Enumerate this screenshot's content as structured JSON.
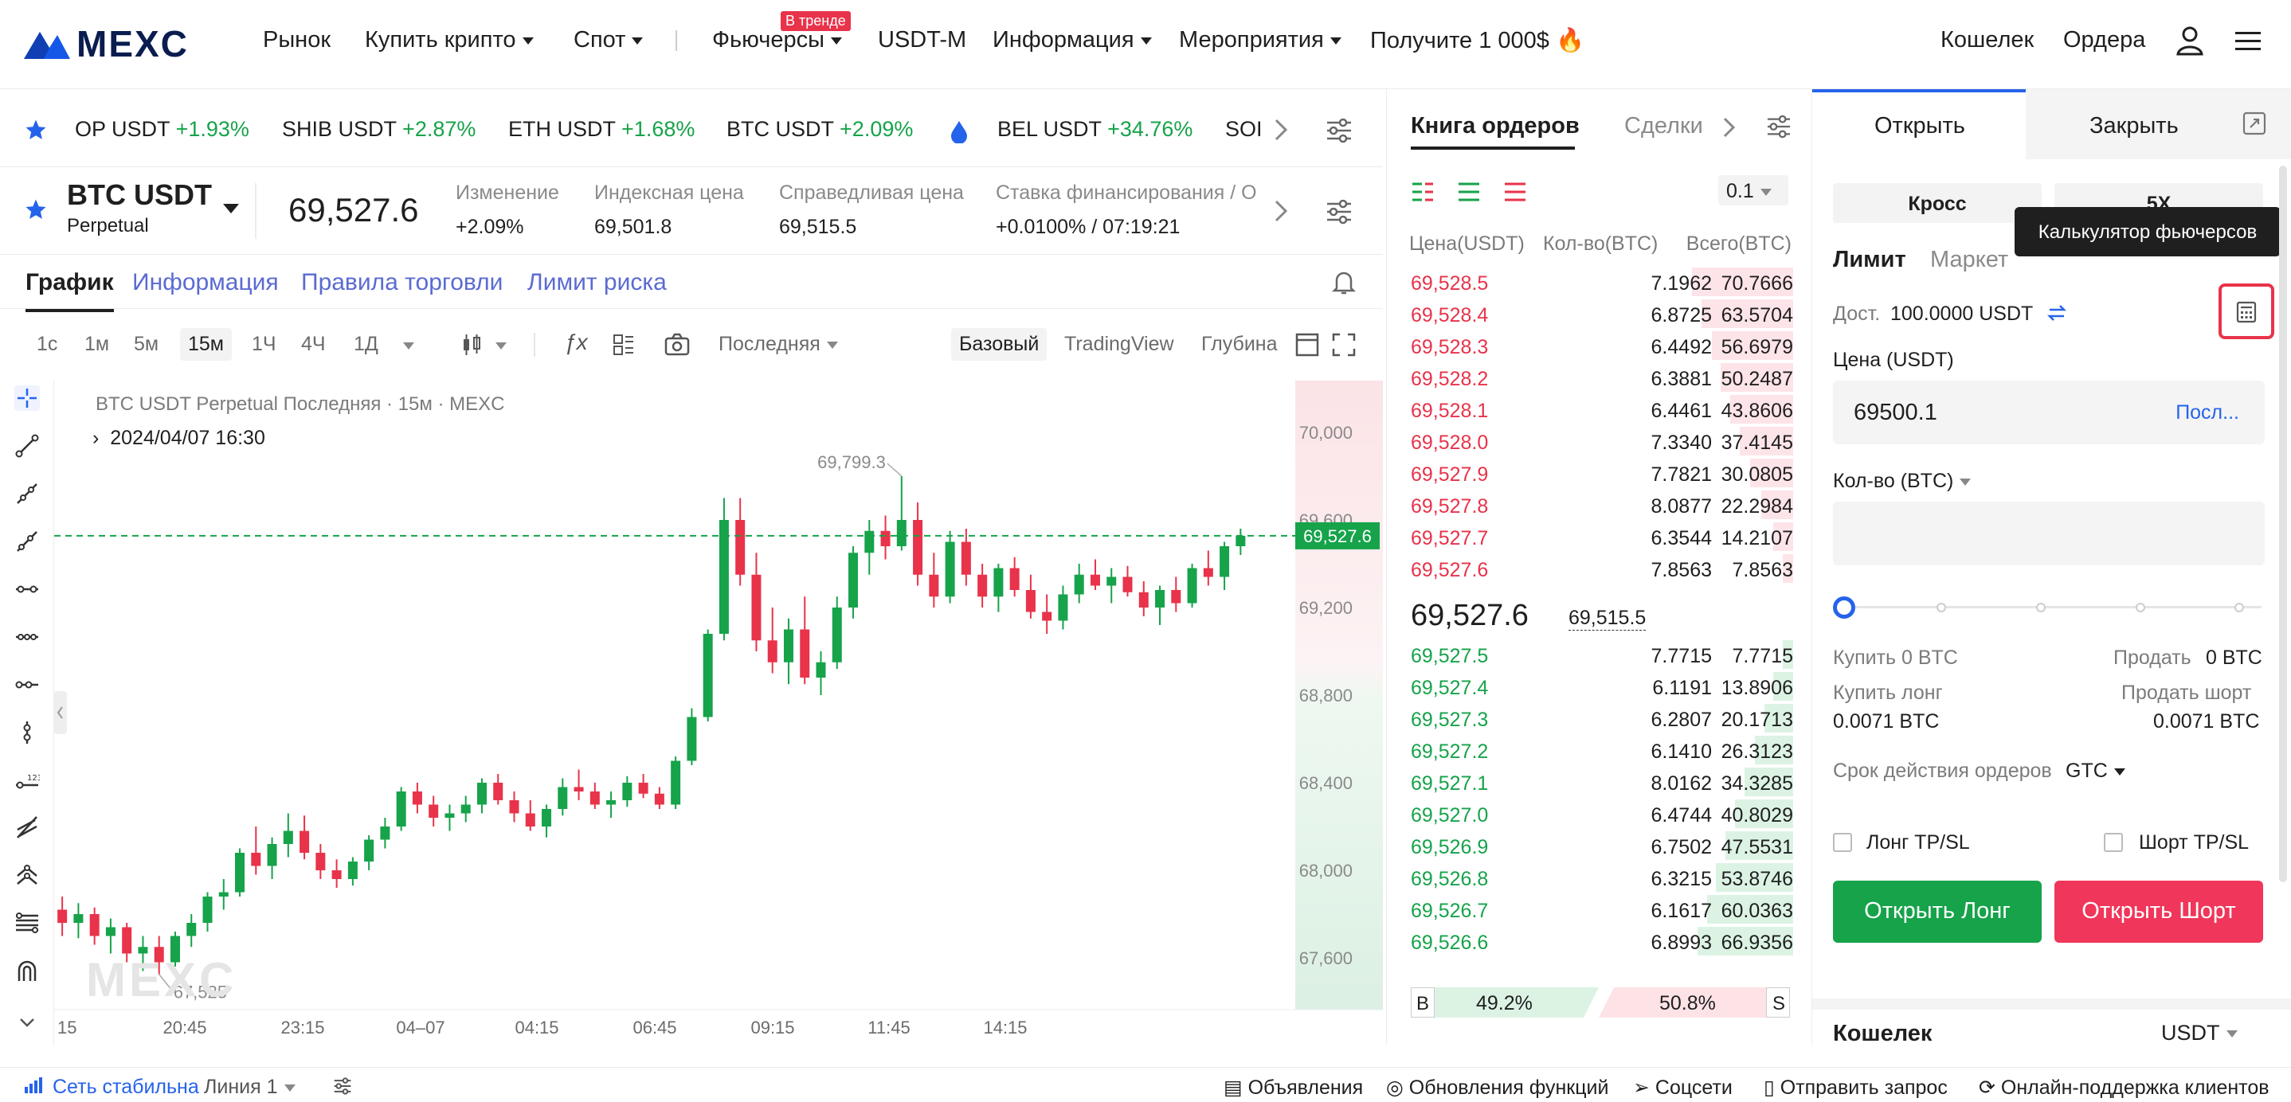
{
  "nav": {
    "brand": "MEXC",
    "items": [
      "Рынок",
      "Купить крипто",
      "Спот",
      "Фьючерсы",
      "USDT-M",
      "Информация",
      "Мероприятия",
      "Получите 1 000$"
    ],
    "trend_badge": "В тренде",
    "right": [
      "Кошелек",
      "Ордера"
    ]
  },
  "ticker": [
    {
      "pair": "OP USDT",
      "chg": "+1.93%"
    },
    {
      "pair": "SHIB USDT",
      "chg": "+2.87%"
    },
    {
      "pair": "ETH USDT",
      "chg": "+1.68%"
    },
    {
      "pair": "BTC USDT",
      "chg": "+2.09%"
    },
    {
      "pair": "BEL USDT",
      "chg": "+34.76%"
    },
    {
      "pair": "SOI",
      "chg": ""
    }
  ],
  "symbol": {
    "name": "BTC USDT",
    "sub": "Perpetual",
    "price": "69,527.6",
    "stats": [
      {
        "label": "Изменение",
        "value": "+2.09%"
      },
      {
        "label": "Индексная цена",
        "value": "69,501.8"
      },
      {
        "label": "Справедливая цена",
        "value": "69,515.5"
      },
      {
        "label": "Ставка финансирования / О",
        "value": "+0.0100% / 07:19:21"
      }
    ]
  },
  "chart_tabs": [
    "График",
    "Информация",
    "Правила торговли",
    "Лимит риска"
  ],
  "toolbar": {
    "timeframes": [
      "1с",
      "1м",
      "5м",
      "15м",
      "1Ч",
      "4Ч",
      "1Д"
    ],
    "active_tf": "15м",
    "price_type": "Последняя",
    "views": [
      "Базовый",
      "TradingView",
      "Глубина"
    ]
  },
  "chart_info": {
    "legend": "BTC USDT Perpetual Последняя · 15м · MEXC",
    "date": "2024/04/07 16:30",
    "high_label": "69,799.3",
    "low_label": "67,525",
    "current": "69,527.6",
    "watermark": "MEXC"
  },
  "chart_data": {
    "type": "candlestick",
    "y_ticks": [
      "70,000",
      "69,600",
      "69,200",
      "68,800",
      "68,400",
      "68,000",
      "67,600"
    ],
    "x_ticks": [
      "15",
      "20:45",
      "23:15",
      "04–07",
      "04:15",
      "06:45",
      "09:15",
      "11:45",
      "14:15"
    ],
    "ylim": [
      67400,
      70200
    ],
    "candles": [
      [
        67820,
        67880,
        67700,
        67760
      ],
      [
        67760,
        67850,
        67690,
        67800
      ],
      [
        67800,
        67830,
        67660,
        67700
      ],
      [
        67700,
        67780,
        67620,
        67740
      ],
      [
        67740,
        67760,
        67580,
        67620
      ],
      [
        67620,
        67700,
        67540,
        67650
      ],
      [
        67650,
        67700,
        67525,
        67580
      ],
      [
        67580,
        67720,
        67560,
        67700
      ],
      [
        67700,
        67800,
        67650,
        67760
      ],
      [
        67760,
        67900,
        67720,
        67880
      ],
      [
        67880,
        67960,
        67820,
        67900
      ],
      [
        67900,
        68100,
        67880,
        68080
      ],
      [
        68080,
        68200,
        67980,
        68020
      ],
      [
        68020,
        68150,
        67960,
        68120
      ],
      [
        68120,
        68260,
        68060,
        68180
      ],
      [
        68180,
        68250,
        68050,
        68080
      ],
      [
        68080,
        68120,
        67960,
        68000
      ],
      [
        68000,
        68050,
        67920,
        67960
      ],
      [
        67960,
        68060,
        67930,
        68040
      ],
      [
        68040,
        68160,
        68000,
        68140
      ],
      [
        68140,
        68240,
        68100,
        68200
      ],
      [
        68200,
        68380,
        68180,
        68360
      ],
      [
        68360,
        68400,
        68260,
        68300
      ],
      [
        68300,
        68340,
        68200,
        68240
      ],
      [
        68240,
        68300,
        68180,
        68260
      ],
      [
        68260,
        68340,
        68220,
        68300
      ],
      [
        68300,
        68420,
        68260,
        68400
      ],
      [
        68400,
        68440,
        68300,
        68320
      ],
      [
        68320,
        68360,
        68220,
        68260
      ],
      [
        68260,
        68320,
        68180,
        68200
      ],
      [
        68200,
        68300,
        68150,
        68280
      ],
      [
        68280,
        68420,
        68250,
        68380
      ],
      [
        68380,
        68460,
        68320,
        68360
      ],
      [
        68360,
        68400,
        68280,
        68300
      ],
      [
        68300,
        68360,
        68240,
        68320
      ],
      [
        68320,
        68430,
        68290,
        68400
      ],
      [
        68400,
        68440,
        68330,
        68350
      ],
      [
        68350,
        68380,
        68280,
        68300
      ],
      [
        68300,
        68520,
        68280,
        68500
      ],
      [
        68500,
        68740,
        68480,
        68700
      ],
      [
        68700,
        69100,
        68680,
        69080
      ],
      [
        69080,
        69700,
        69050,
        69600
      ],
      [
        69600,
        69700,
        69300,
        69350
      ],
      [
        69350,
        69450,
        69000,
        69050
      ],
      [
        69050,
        69200,
        68900,
        68950
      ],
      [
        68950,
        69150,
        68850,
        69100
      ],
      [
        69100,
        69250,
        68850,
        68880
      ],
      [
        68880,
        69000,
        68800,
        68950
      ],
      [
        68950,
        69250,
        68920,
        69200
      ],
      [
        69200,
        69480,
        69150,
        69450
      ],
      [
        69450,
        69600,
        69350,
        69550
      ],
      [
        69550,
        69620,
        69420,
        69480
      ],
      [
        69480,
        69800,
        69460,
        69600
      ],
      [
        69600,
        69680,
        69300,
        69350
      ],
      [
        69350,
        69450,
        69200,
        69250
      ],
      [
        69250,
        69550,
        69220,
        69500
      ],
      [
        69500,
        69560,
        69300,
        69350
      ],
      [
        69350,
        69400,
        69200,
        69250
      ],
      [
        69250,
        69400,
        69180,
        69380
      ],
      [
        69380,
        69430,
        69250,
        69280
      ],
      [
        69280,
        69350,
        69150,
        69180
      ],
      [
        69180,
        69260,
        69080,
        69140
      ],
      [
        69140,
        69300,
        69100,
        69260
      ],
      [
        69260,
        69400,
        69220,
        69350
      ],
      [
        69350,
        69420,
        69280,
        69300
      ],
      [
        69300,
        69380,
        69220,
        69340
      ],
      [
        69340,
        69390,
        69250,
        69270
      ],
      [
        69270,
        69320,
        69160,
        69200
      ],
      [
        69200,
        69300,
        69120,
        69280
      ],
      [
        69280,
        69340,
        69180,
        69220
      ],
      [
        69220,
        69400,
        69200,
        69380
      ],
      [
        69380,
        69460,
        69300,
        69340
      ],
      [
        69340,
        69500,
        69280,
        69480
      ],
      [
        69480,
        69560,
        69440,
        69527.6
      ]
    ]
  },
  "orderbook": {
    "tabs": [
      "Книга ордеров",
      "Сделки"
    ],
    "step": "0.1",
    "headers": [
      "Цена(USDT)",
      "Кол-во(BTC)",
      "Всего(BTC)"
    ],
    "asks": [
      [
        "69,528.5",
        "7.1962",
        "70.7666",
        0.85
      ],
      [
        "69,528.4",
        "6.8725",
        "63.5704",
        0.77
      ],
      [
        "69,528.3",
        "6.4492",
        "56.6979",
        0.68
      ],
      [
        "69,528.2",
        "6.3881",
        "50.2487",
        0.61
      ],
      [
        "69,528.1",
        "6.4461",
        "43.8606",
        0.53
      ],
      [
        "69,528.0",
        "7.3340",
        "37.4145",
        0.45
      ],
      [
        "69,527.9",
        "7.7821",
        "30.0805",
        0.36
      ],
      [
        "69,527.8",
        "8.0877",
        "22.2984",
        0.27
      ],
      [
        "69,527.7",
        "6.3544",
        "14.2107",
        0.17
      ],
      [
        "69,527.6",
        "7.8563",
        "7.8563",
        0.09
      ]
    ],
    "mid": "69,527.6",
    "mid_mark": "69,515.5",
    "bids": [
      [
        "69,527.5",
        "7.7715",
        "7.7715",
        0.09
      ],
      [
        "69,527.4",
        "6.1191",
        "13.8906",
        0.17
      ],
      [
        "69,527.3",
        "6.2807",
        "20.1713",
        0.24
      ],
      [
        "69,527.2",
        "6.1410",
        "26.3123",
        0.32
      ],
      [
        "69,527.1",
        "8.0162",
        "34.3285",
        0.41
      ],
      [
        "69,527.0",
        "6.4744",
        "40.8029",
        0.49
      ],
      [
        "69,526.9",
        "6.7502",
        "47.5531",
        0.57
      ],
      [
        "69,526.8",
        "6.3215",
        "53.8746",
        0.65
      ],
      [
        "69,526.7",
        "6.1617",
        "60.0363",
        0.72
      ],
      [
        "69,526.6",
        "6.8993",
        "66.9356",
        0.8
      ]
    ],
    "b_pct": "49.2%",
    "s_pct": "50.8%",
    "b": "B",
    "s": "S"
  },
  "trade": {
    "tabs": [
      "Открыть",
      "Закрыть"
    ],
    "margin": "Кросс",
    "leverage": "5X",
    "tooltip": "Калькулятор фьючерсов",
    "order_types": [
      "Лимит",
      "Маркет"
    ],
    "avail_label": "Дост.",
    "avail": "100.0000 USDT",
    "price_label": "Цена (USDT)",
    "price": "69500.1",
    "last": "Посл...",
    "qty_label": "Кол-во (BTC)",
    "buy_label": "Купить 0 BTC",
    "sell_label": "Продать",
    "sell_val": "0 BTC",
    "buy_long": "Купить лонг",
    "buy_long_val": "0.0071 BTC",
    "sell_short": "Продать шорт",
    "sell_short_val": "0.0071 BTC",
    "tif_label": "Срок действия ордеров",
    "tif": "GTC",
    "long_tpsl": "Лонг TP/SL",
    "short_tpsl": "Шорт TP/SL",
    "open_long": "Открыть Лонг",
    "open_short": "Открыть Шорт",
    "wallet": "Кошелек",
    "wallet_cur": "USDT"
  },
  "bottom": {
    "status": "Сеть стабильна",
    "line": "Линия 1",
    "links": [
      "Объявления",
      "Обновления функций",
      "Соцсети",
      "Отправить запрос",
      "Онлайн-поддержка клиентов"
    ]
  },
  "colors": {
    "up": "#16a34a",
    "down": "#e8334a",
    "accent": "#2563eb"
  }
}
